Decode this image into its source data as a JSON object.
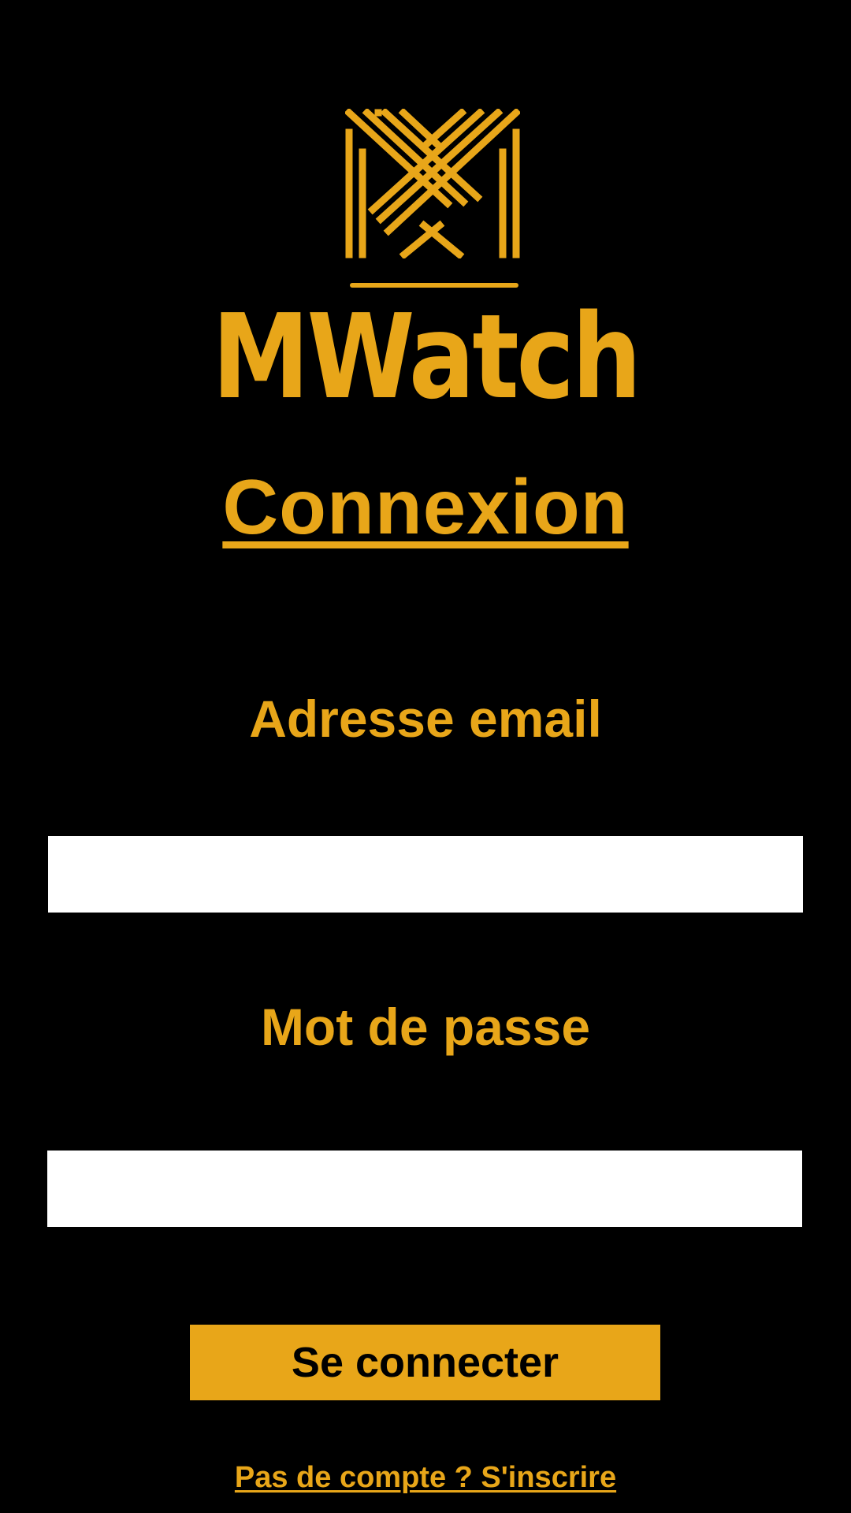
{
  "brand": {
    "name": "MWatch",
    "logo_icon": "mw-monogram-logo",
    "color": "#E8A619"
  },
  "page": {
    "title": "Connexion",
    "background": "#000000"
  },
  "form": {
    "email": {
      "label": "Adresse email",
      "value": "",
      "placeholder": ""
    },
    "password": {
      "label": "Mot de passe",
      "value": "",
      "placeholder": ""
    },
    "submit_label": "Se connecter",
    "submit_color": "#E8A619"
  },
  "footer": {
    "signup_link": "Pas de compte ? S'inscrire"
  }
}
